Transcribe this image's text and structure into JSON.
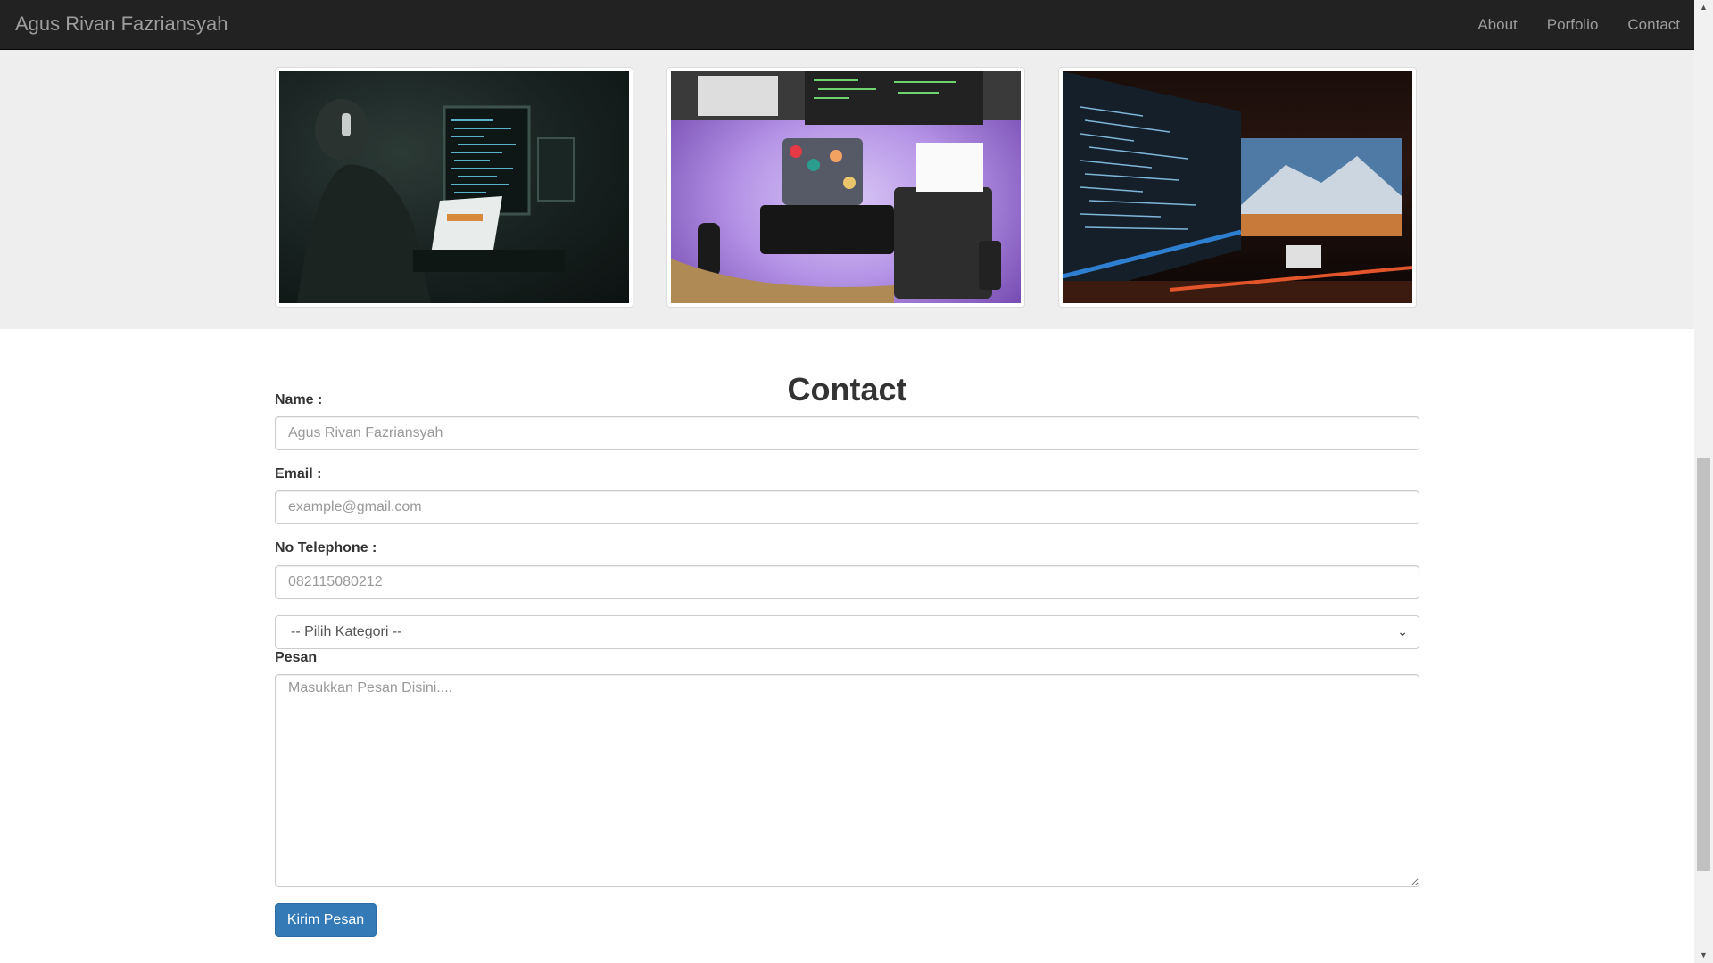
{
  "navbar": {
    "brand": "Agus Rivan Fazriansyah",
    "links": [
      {
        "label": "About"
      },
      {
        "label": "Porfolio"
      },
      {
        "label": "Contact"
      }
    ]
  },
  "contact": {
    "title": "Contact",
    "name_label": "Name :",
    "name_placeholder": "Agus Rivan Fazriansyah",
    "email_label": "Email :",
    "email_placeholder": "example@gmail.com",
    "phone_label": "No Telephone :",
    "phone_placeholder": "082115080212",
    "category_selected": "-- Pilih Kategori --",
    "message_label": "Pesan",
    "message_placeholder": "Masukkan Pesan Disini....",
    "submit_label": "Kirim Pesan"
  },
  "icons": {
    "select_chevron": "chevron-down-icon",
    "scroll_up": "arrow-up-icon",
    "scroll_down": "arrow-down-icon"
  },
  "colors": {
    "navbar_bg": "#222222",
    "nav_text": "#9d9d9d",
    "gallery_bg": "#eeeeee",
    "button_primary": "#337ab7"
  }
}
